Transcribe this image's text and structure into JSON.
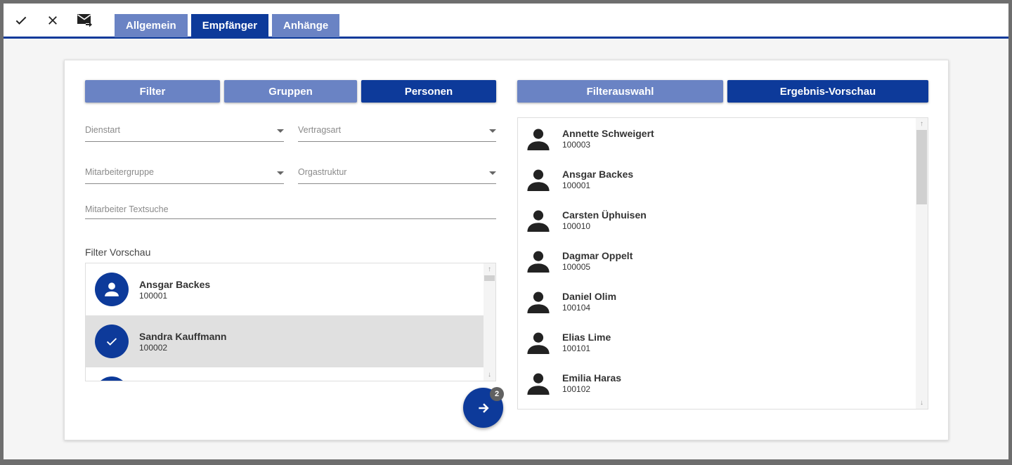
{
  "toolbar": {
    "confirm_icon": "check-icon",
    "cancel_icon": "close-icon",
    "send_icon": "mail-send-icon"
  },
  "tabs": [
    {
      "label": "Allgemein",
      "active": false
    },
    {
      "label": "Empfänger",
      "active": true
    },
    {
      "label": "Anhänge",
      "active": false
    }
  ],
  "left": {
    "segments": [
      {
        "label": "Filter",
        "active": false
      },
      {
        "label": "Gruppen",
        "active": false
      },
      {
        "label": "Personen",
        "active": true
      }
    ],
    "fields": {
      "dienstart": "Dienstart",
      "vertragsart": "Vertragsart",
      "mitarbeitergruppe": "Mitarbeitergruppe",
      "orgastruktur": "Orgastruktur",
      "textsuche_placeholder": "Mitarbeiter Textsuche"
    },
    "preview_title": "Filter Vorschau",
    "preview_items": [
      {
        "name": "Ansgar Backes",
        "id": "100001",
        "selected": false
      },
      {
        "name": "Sandra Kauffmann",
        "id": "100002",
        "selected": true
      }
    ]
  },
  "fab": {
    "icon": "arrow-right-icon",
    "badge": "2"
  },
  "right": {
    "segments": [
      {
        "label": "Filterauswahl",
        "active": false
      },
      {
        "label": "Ergebnis-Vorschau",
        "active": true
      }
    ],
    "results": [
      {
        "name": "Annette Schweigert",
        "id": "100003"
      },
      {
        "name": "Ansgar Backes",
        "id": "100001"
      },
      {
        "name": "Carsten Üphuisen",
        "id": "100010"
      },
      {
        "name": "Dagmar Oppelt",
        "id": "100005"
      },
      {
        "name": "Daniel Olim",
        "id": "100104"
      },
      {
        "name": "Elias Lime",
        "id": "100101"
      },
      {
        "name": "Emilia Haras",
        "id": "100102"
      }
    ]
  },
  "colors": {
    "primary": "#0d3a9a",
    "secondary": "#6a83c4"
  }
}
